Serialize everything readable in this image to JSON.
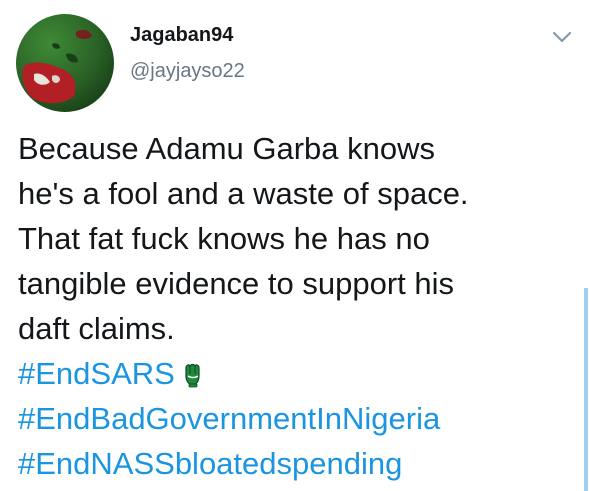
{
  "tweet": {
    "display_name": "Jagaban94",
    "handle": "@jayjayso22",
    "body_lines": [
      "Because Adamu Garba knows",
      "he's a fool and a waste of space.",
      "That fat fuck knows he has no",
      "tangible evidence to support his",
      "daft claims."
    ],
    "hashtags": [
      "#EndSARS",
      "#EndBadGovernmentInNigeria",
      "#EndNASSbloatedspending"
    ],
    "emoji": "raised-fist-emoji-green"
  },
  "colors": {
    "text": "#14171a",
    "secondary": "#657786",
    "link": "#1b95e0",
    "avatar_green": "#2e6b2a",
    "avatar_red": "#b21f24",
    "emoji_green": "#1f8a3c",
    "scrollbar": "#9fd0ef"
  },
  "icons": {
    "more": "chevron-down-icon"
  }
}
